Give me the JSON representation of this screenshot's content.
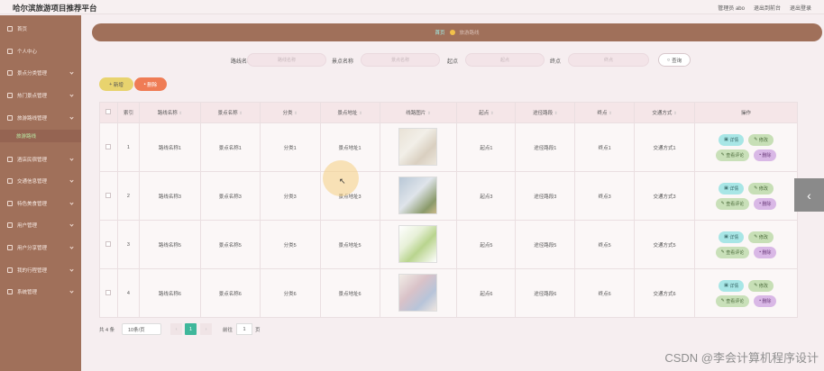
{
  "header": {
    "title": "哈尔滨旅游项目推荐平台",
    "links": [
      "管理员 abo",
      "退出到前台",
      "退出登录"
    ]
  },
  "sidebar": {
    "items": [
      {
        "label": "首页"
      },
      {
        "label": "个人中心"
      },
      {
        "label": "景点分类管理"
      },
      {
        "label": "热门景点管理"
      },
      {
        "label": "旅游路线管理"
      },
      {
        "label": "旅游路线",
        "sub": true
      },
      {
        "label": "酒店民宿管理"
      },
      {
        "label": "交通信息管理"
      },
      {
        "label": "特色美食管理"
      },
      {
        "label": "用户管理"
      },
      {
        "label": "用户分享管理"
      },
      {
        "label": "我的行程管理"
      },
      {
        "label": "系统管理"
      }
    ]
  },
  "breadcrumb": {
    "home": "首页",
    "current": "旅游路线"
  },
  "search": {
    "route_label": "路线名称",
    "route_ph": "路线名称",
    "spot_label": "景点名称",
    "spot_ph": "景点名称",
    "start_label": "起点",
    "start_ph": "起点",
    "end_label": "终点",
    "end_ph": "终点",
    "button": "查询"
  },
  "actions": {
    "add": "新增",
    "delete": "删除"
  },
  "table": {
    "headers": [
      "索引",
      "路线名称",
      "景点名称",
      "分类",
      "景点地址",
      "线路图片",
      "起点",
      "途径路段",
      "终点",
      "交通方式",
      "操作"
    ],
    "rows": [
      {
        "index": "1",
        "route": "路线名称1",
        "spot": "景点名称1",
        "category": "分类1",
        "address": "景点地址1",
        "start": "起点1",
        "via": "途径路段1",
        "end": "终点1",
        "transport": "交通方式1"
      },
      {
        "index": "2",
        "route": "路线名称3",
        "spot": "景点名称3",
        "category": "分类3",
        "address": "景点地址3",
        "start": "起点3",
        "via": "途径路段3",
        "end": "终点3",
        "transport": "交通方式3"
      },
      {
        "index": "3",
        "route": "路线名称5",
        "spot": "景点名称5",
        "category": "分类5",
        "address": "景点地址5",
        "start": "起点5",
        "via": "途径路段5",
        "end": "终点5",
        "transport": "交通方式5"
      },
      {
        "index": "4",
        "route": "路线名称6",
        "spot": "景点名称6",
        "category": "分类6",
        "address": "景点地址6",
        "start": "起点6",
        "via": "途径路段6",
        "end": "终点6",
        "transport": "交通方式6"
      }
    ],
    "ops": {
      "detail": "详情",
      "edit": "修改",
      "comment": "查看评论",
      "delete": "删除"
    }
  },
  "pagination": {
    "total": "共 4 条",
    "page_size": "10条/页",
    "current": "1",
    "goto": "前往",
    "goto_value": "1",
    "page_unit": "页"
  },
  "watermark": "CSDN @李会计算机程序设计",
  "colors": {
    "sidebar": "#a0705a",
    "accent": "#3fb79b"
  }
}
